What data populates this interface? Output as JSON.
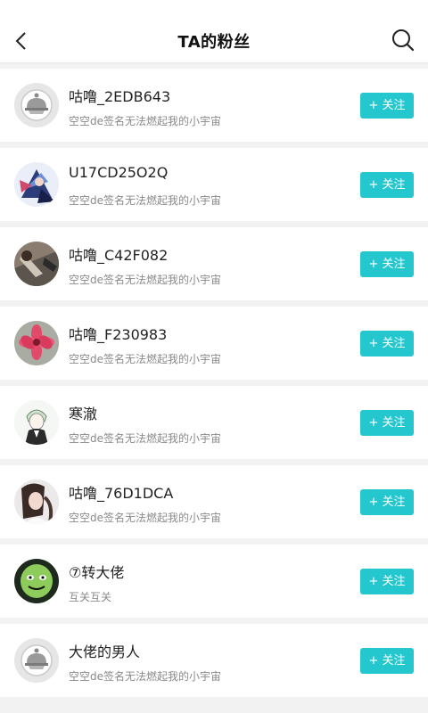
{
  "header": {
    "title": "TA的粉丝",
    "back_icon": "chevron-left-icon",
    "search_icon": "search-icon"
  },
  "accent": "#25c7cf",
  "followers": [
    {
      "name": "咕噜_2EDB643",
      "signature": "空空de签名无法燃起我的小宇宙",
      "button": "+ 关注",
      "avatar": "default-avatar"
    },
    {
      "name": "U17CD25O2Q",
      "signature": "空空de签名无法燃起我的小宇宙",
      "button": "+ 关注",
      "avatar": "anime-avatar"
    },
    {
      "name": "咕噜_C42F082",
      "signature": "空空de签名无法燃起我的小宇宙",
      "button": "+ 关注",
      "avatar": "photo-avatar"
    },
    {
      "name": "咕噜_F230983",
      "signature": "空空de签名无法燃起我的小宇宙",
      "button": "+ 关注",
      "avatar": "flower-avatar"
    },
    {
      "name": "寒澈",
      "signature": "空空de签名无法燃起我的小宇宙",
      "button": "+ 关注",
      "avatar": "sketch-avatar"
    },
    {
      "name": "咕噜_76D1DCA",
      "signature": "空空de签名无法燃起我的小宇宙",
      "button": "+ 关注",
      "avatar": "portrait-avatar"
    },
    {
      "name": "⑦转大佬",
      "signature": "互关互关",
      "button": "+ 关注",
      "avatar": "meme-avatar"
    },
    {
      "name": "大佬的男人",
      "signature": "空空de签名无法燃起我的小宇宙",
      "button": "+ 关注",
      "avatar": "default-avatar"
    }
  ]
}
